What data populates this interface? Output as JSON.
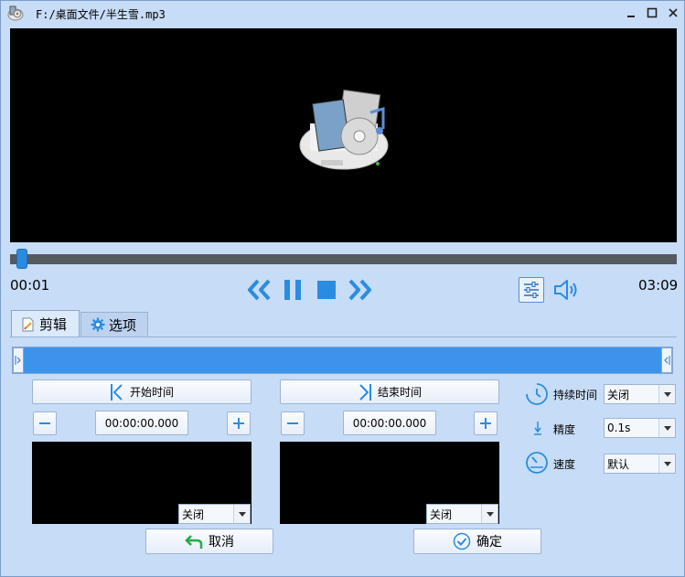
{
  "window": {
    "title": "F:/桌面文件/半生雪.mp3"
  },
  "player": {
    "current_time": "00:01",
    "total_time": "03:09",
    "progress_fraction": 0.01
  },
  "tabs": [
    {
      "label": "剪辑",
      "icon": "edit-doc-icon",
      "active": true
    },
    {
      "label": "选项",
      "icon": "gear-icon",
      "active": false
    }
  ],
  "clip": {
    "start_button": "开始时间",
    "end_button": "结束时间",
    "start_time": "00:00:00.000",
    "end_time": "00:00:00.000",
    "start_preview_select": "关闭",
    "end_preview_select": "关闭",
    "cancel_label": "取消",
    "confirm_label": "确定"
  },
  "options": {
    "duration_label": "持续时间",
    "duration_value": "关闭",
    "precision_label": "精度",
    "precision_value": "0.1s",
    "speed_label": "速度",
    "speed_value": "默认"
  },
  "colors": {
    "window_bg": "#c7dcf6",
    "accent_blue": "#2a8ce0",
    "range_bar": "#3d93ea",
    "video_bg": "#000000"
  }
}
